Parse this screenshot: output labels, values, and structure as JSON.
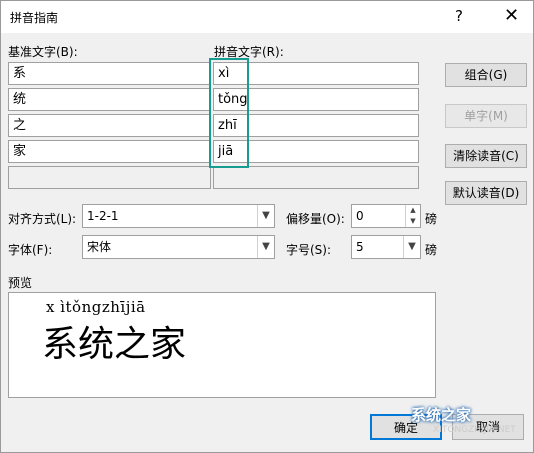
{
  "window": {
    "title": "拼音指南",
    "help_glyph": "?",
    "close_glyph": "✕"
  },
  "labels": {
    "base": "基准文字(B):",
    "pinyin": "拼音文字(R):",
    "align": "对齐方式(L):",
    "offset": "偏移量(O):",
    "font": "字体(F):",
    "size": "字号(S):",
    "unit1": "磅",
    "unit2": "磅",
    "preview": "预览"
  },
  "rows": [
    {
      "base": "系",
      "pinyin": "xì"
    },
    {
      "base": "统",
      "pinyin": "tǒng"
    },
    {
      "base": "之",
      "pinyin": "zhī"
    },
    {
      "base": "家",
      "pinyin": "jiā"
    },
    {
      "base": "",
      "pinyin": ""
    }
  ],
  "buttons": {
    "combine": "组合(G)",
    "single": "单字(M)",
    "clear": "清除读音(C)",
    "default": "默认读音(D)",
    "ok": "确定",
    "cancel": "取消"
  },
  "fields": {
    "align_value": "1-2-1",
    "offset_value": "0",
    "font_value": "宋体",
    "size_value": "5"
  },
  "preview": {
    "pinyin_line": "x ìtǒngzhījiā",
    "text_line": "系统之家"
  },
  "watermark": {
    "text": "系统之家",
    "url": "XITONGZHIJIA.NET"
  },
  "colors": {
    "highlight": "#179c92",
    "ok_border": "#0078d7"
  }
}
